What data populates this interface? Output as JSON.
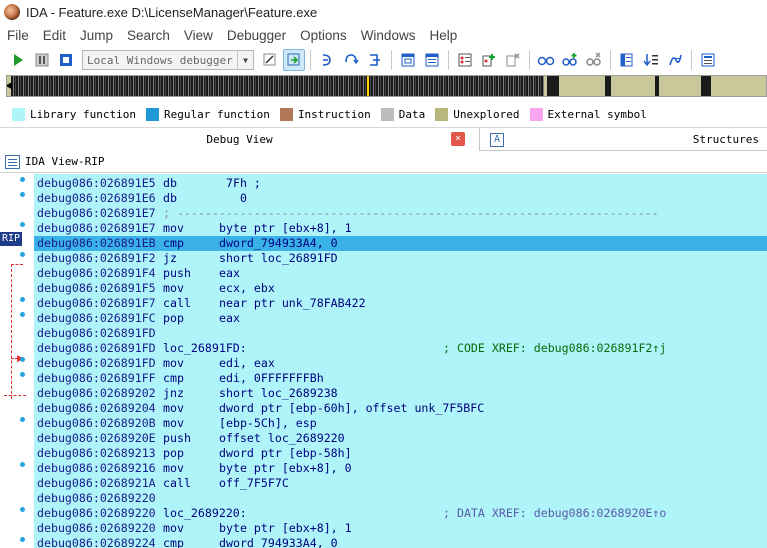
{
  "window": {
    "title": "IDA - Feature.exe D:\\LicenseManager\\Feature.exe"
  },
  "menu": [
    "File",
    "Edit",
    "Jump",
    "Search",
    "View",
    "Debugger",
    "Options",
    "Windows",
    "Help"
  ],
  "toolbar": {
    "debugger_select": "Local Windows debugger",
    "buttons": [
      "play-icon",
      "pause-icon",
      "stop-icon",
      "attach-icon",
      "detach-icon",
      "step-into-icon",
      "step-over-icon",
      "run-to-cursor-icon",
      "window-icon",
      "window-icon",
      "breakpoint-list-icon",
      "add-breakpoint-icon",
      "delete-breakpoint-icon",
      "glasses-icon",
      "add-watch-icon",
      "delete-watch-icon",
      "function-icon",
      "list-icon",
      "trace-icon",
      "graph-icon"
    ]
  },
  "legend": [
    {
      "label": "Library function",
      "color": "#aef4f8"
    },
    {
      "label": "Regular function",
      "color": "#1f98d6"
    },
    {
      "label": "Instruction",
      "color": "#b07858"
    },
    {
      "label": "Data",
      "color": "#bdbdbd"
    },
    {
      "label": "Unexplored",
      "color": "#b8b87c"
    },
    {
      "label": "External symbol",
      "color": "#f7a5f0"
    }
  ],
  "tabs": {
    "debug_view": "Debug View",
    "structures": "Structures",
    "close_symbol": "×",
    "structures_icon": "A"
  },
  "ida_view": {
    "title": "IDA View-RIP",
    "rip_label": "RIP"
  },
  "lines": [
    {
      "addr": "debug086:026891E5",
      "mn": "db",
      "op": " 7Fh ;"
    },
    {
      "addr": "debug086:026891E6",
      "mn": "db",
      "op": "   0"
    },
    {
      "addr": "debug086:026891E7",
      "sep": "; ---------------------------------------------------------------------"
    },
    {
      "addr": "debug086:026891E7",
      "mn": "mov",
      "op": "byte ptr [ebx+8], 1"
    },
    {
      "addr": "debug086:026891EB",
      "mn": "cmp",
      "op": "dword_794933A4, 0",
      "highlight": true
    },
    {
      "addr": "debug086:026891F2",
      "mn": "jz",
      "op": "short loc_26891FD"
    },
    {
      "addr": "debug086:026891F4",
      "mn": "push",
      "op": "eax"
    },
    {
      "addr": "debug086:026891F5",
      "mn": "mov",
      "op": "ecx, ebx"
    },
    {
      "addr": "debug086:026891F7",
      "mn": "call",
      "op": "near ptr unk_78FAB422"
    },
    {
      "addr": "debug086:026891FC",
      "mn": "pop",
      "op": "eax"
    },
    {
      "addr": "debug086:026891FD"
    },
    {
      "addr": "debug086:026891FD",
      "label": "loc_26891FD:",
      "cmt": "; CODE XREF: debug086:026891F2↑j"
    },
    {
      "addr": "debug086:026891FD",
      "mn": "mov",
      "op": "edi, eax"
    },
    {
      "addr": "debug086:026891FF",
      "mn": "cmp",
      "op": "edi, 0FFFFFFFBh"
    },
    {
      "addr": "debug086:02689202",
      "mn": "jnz",
      "op": "short loc_2689238"
    },
    {
      "addr": "debug086:02689204",
      "mn": "mov",
      "op": "dword ptr [ebp-60h], offset unk_7F5BFC"
    },
    {
      "addr": "debug086:0268920B",
      "mn": "mov",
      "op": "[ebp-5Ch], esp"
    },
    {
      "addr": "debug086:0268920E",
      "mn": "push",
      "op": "offset loc_2689220"
    },
    {
      "addr": "debug086:02689213",
      "mn": "pop",
      "op": "dword ptr [ebp-58h]"
    },
    {
      "addr": "debug086:02689216",
      "mn": "mov",
      "op": "byte ptr [ebx+8], 0"
    },
    {
      "addr": "debug086:0268921A",
      "mn": "call",
      "op": "off_7F5F7C"
    },
    {
      "addr": "debug086:02689220"
    },
    {
      "addr": "debug086:02689220",
      "label": "loc_2689220:",
      "cmt": "; DATA XREF: debug086:0268920E↑o",
      "cmt_type": "data"
    },
    {
      "addr": "debug086:02689220",
      "mn": "mov",
      "op": "byte ptr [ebx+8], 1"
    },
    {
      "addr": "debug086:02689224",
      "mn": "cmp",
      "op": "dword_794933A4, 0"
    }
  ]
}
